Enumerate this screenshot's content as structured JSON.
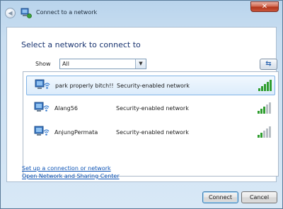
{
  "window": {
    "title": "Connect to a network",
    "close_label": "✕"
  },
  "main": {
    "heading": "Select a network to connect to",
    "show_label": "Show",
    "show_value": "All",
    "refresh_symbol": "⇆"
  },
  "networks": [
    {
      "name": "park properly bitch!!",
      "security": "Security-enabled network",
      "signal_bars": 5,
      "selected": true
    },
    {
      "name": "Alang56",
      "security": "Security-enabled network",
      "signal_bars": 3,
      "selected": false
    },
    {
      "name": "AnjungPermata",
      "security": "Security-enabled network",
      "signal_bars": 2,
      "selected": false
    }
  ],
  "links": {
    "setup": "Set up a connection or network",
    "sharing_center": "Open Network and Sharing Center"
  },
  "buttons": {
    "connect": "Connect",
    "cancel": "Cancel"
  },
  "colors": {
    "signal_active": "#2f9e2f",
    "signal_inactive": "#b9bfc5",
    "link": "#0c53b5",
    "heading": "#18336f"
  }
}
